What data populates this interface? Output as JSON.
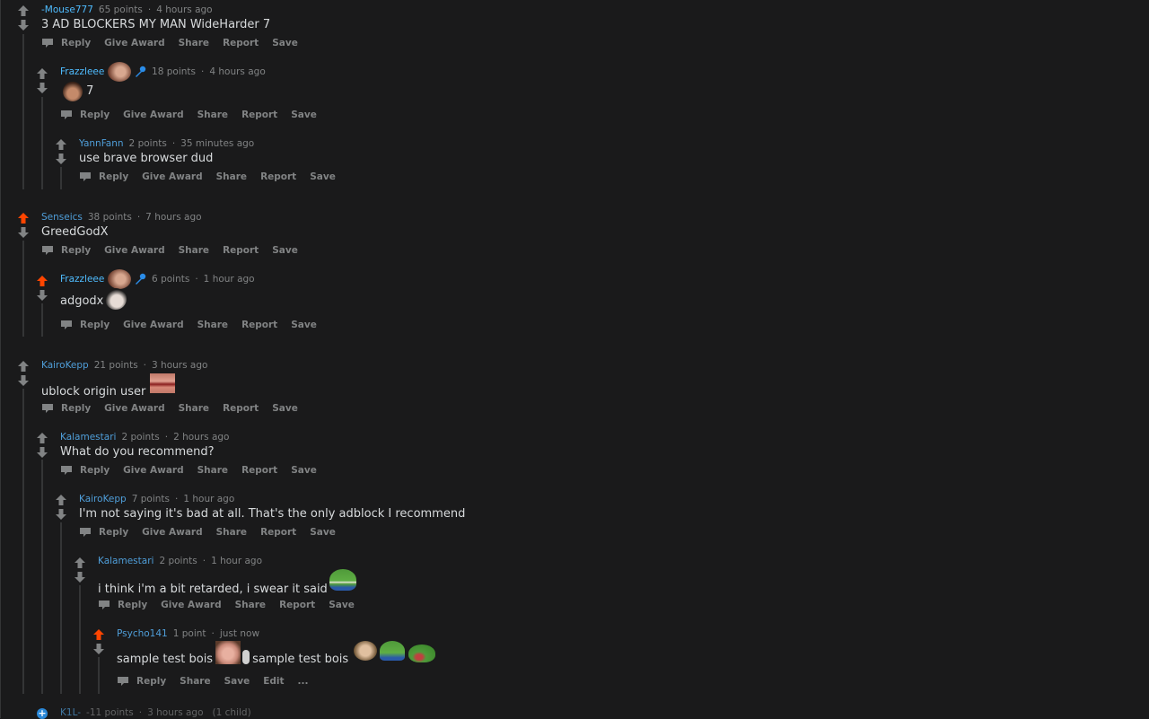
{
  "colors": {
    "background": "#1a1a1b",
    "author": "#4fbcff",
    "meta": "#818384",
    "upvoted": "#ff4500",
    "thread_line": "#343536"
  },
  "actions_full": [
    "Reply",
    "Give Award",
    "Share",
    "Report",
    "Save"
  ],
  "actions_own": [
    "Reply",
    "Share",
    "Save",
    "Edit",
    "..."
  ],
  "comments": [
    {
      "author": "-Mouse777",
      "points": "65 points",
      "time": "4 hours ago",
      "body": "3 AD BLOCKERS MY MAN WideHarder 7",
      "upvoted": false
    },
    {
      "author": "Frazzleee",
      "points": "18 points",
      "time": "4 hours ago",
      "body": "7",
      "upvoted": false,
      "flair": [
        "emote-face",
        "mic-icon"
      ],
      "emotes": [
        "emote-face-small"
      ]
    },
    {
      "author": "YannFann",
      "points": "2 points",
      "time": "35 minutes ago",
      "body": "use brave browser dud",
      "upvoted": false
    },
    {
      "author": "Senseics",
      "points": "38 points",
      "time": "7 hours ago",
      "body": "GreedGodX",
      "upvoted": true
    },
    {
      "author": "Frazzleee",
      "points": "6 points",
      "time": "1 hour ago",
      "body": "adgodx",
      "upvoted": true,
      "flair": [
        "emote-face",
        "mic-icon"
      ],
      "emotes": [
        "emote-face-bw"
      ]
    },
    {
      "author": "KairoKepp",
      "points": "21 points",
      "time": "3 hours ago",
      "body": "ublock origin user",
      "upvoted": false,
      "emotes": [
        "emote-mouth"
      ]
    },
    {
      "author": "Kalamestari",
      "points": "2 points",
      "time": "2 hours ago",
      "body": "What do you recommend?",
      "upvoted": false
    },
    {
      "author": "KairoKepp",
      "points": "7 points",
      "time": "1 hour ago",
      "body": "I'm not saying it's bad at all. That's the only adblock I recommend",
      "upvoted": false
    },
    {
      "author": "Kalamestari",
      "points": "2 points",
      "time": "1 hour ago",
      "body": "i think i'm a bit retarded, i swear it said",
      "upvoted": false,
      "emotes": [
        "emote-pepe-grin"
      ]
    },
    {
      "author": "Psycho141",
      "points": "1 point",
      "time": "just now",
      "body_part1": "sample test bois",
      "body_part2": "sample test bois",
      "upvoted": true,
      "emotes": [
        "emote-laugh",
        "emote-small-face",
        "emote-face-tilt",
        "emote-pepe",
        "emote-pepe-happy"
      ]
    }
  ],
  "collapsed": {
    "author": "K1L-",
    "points": "-11 points",
    "time": "3 hours ago",
    "children": "(1 child)"
  }
}
